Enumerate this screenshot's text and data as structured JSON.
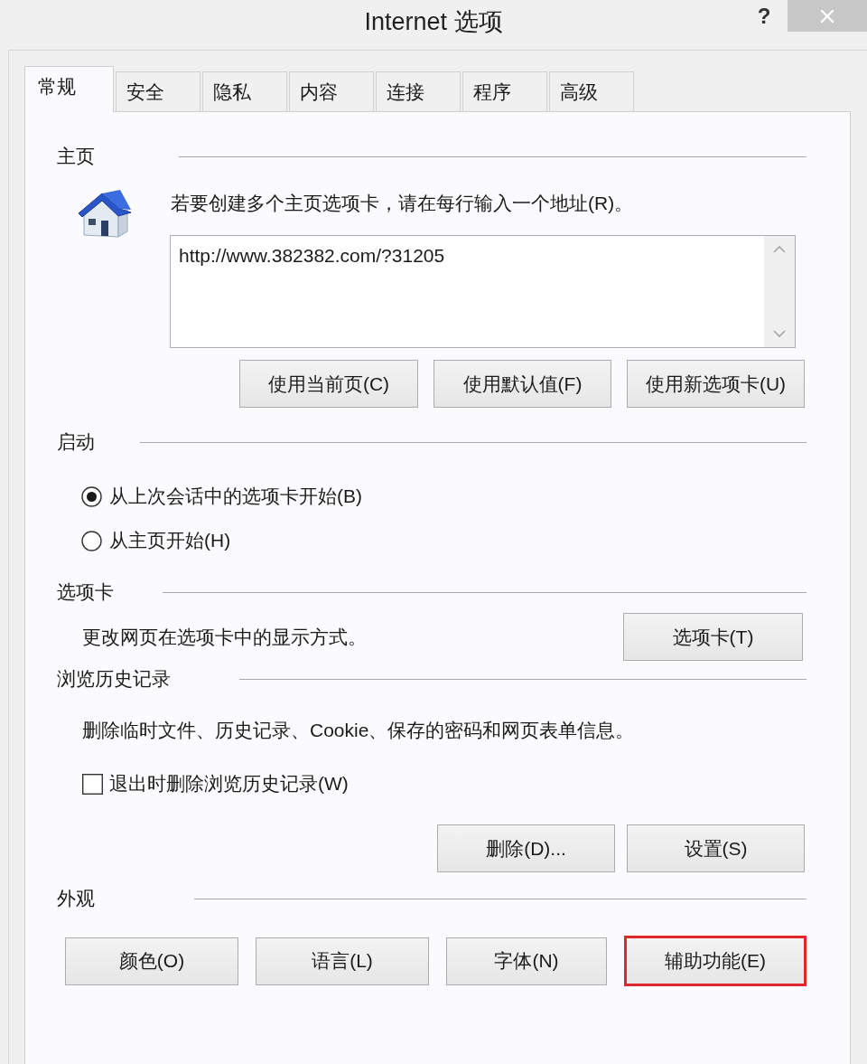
{
  "window": {
    "title": "Internet 选项",
    "help_button": "?"
  },
  "tabs": [
    {
      "label": "常规",
      "selected": true
    },
    {
      "label": "安全",
      "selected": false
    },
    {
      "label": "隐私",
      "selected": false
    },
    {
      "label": "内容",
      "selected": false
    },
    {
      "label": "连接",
      "selected": false
    },
    {
      "label": "程序",
      "selected": false
    },
    {
      "label": "高级",
      "selected": false
    }
  ],
  "sections": [
    {
      "kind": "home",
      "title": "主页",
      "instruction": "若要创建多个主页选项卡，请在每行输入一个地址(R)。",
      "address_box": {
        "value": "http://www.382382.com/?31205"
      },
      "buttons": [
        {
          "label": "使用当前页(C)",
          "highlighted": false
        },
        {
          "label": "使用默认值(F)",
          "highlighted": false
        },
        {
          "label": "使用新选项卡(U)",
          "highlighted": false
        }
      ]
    },
    {
      "kind": "startup",
      "title": "启动",
      "options": [
        {
          "label": "从上次会话中的选项卡开始(B)",
          "selected": true
        },
        {
          "label": "从主页开始(H)",
          "selected": false
        }
      ]
    },
    {
      "kind": "tabs",
      "title": "选项卡",
      "description": "更改网页在选项卡中的显示方式。",
      "buttons": [
        {
          "label": "选项卡(T)",
          "highlighted": false
        }
      ]
    },
    {
      "kind": "history",
      "title": "浏览历史记录",
      "description": "删除临时文件、历史记录、Cookie、保存的密码和网页表单信息。",
      "checkbox": {
        "label": "退出时删除浏览历史记录(W)",
        "checked": false
      },
      "buttons": [
        {
          "label": "删除(D)...",
          "highlighted": false
        },
        {
          "label": "设置(S)",
          "highlighted": false
        }
      ]
    },
    {
      "kind": "appearance",
      "title": "外观",
      "buttons": [
        {
          "label": "颜色(O)",
          "highlighted": false
        },
        {
          "label": "语言(L)",
          "highlighted": false
        },
        {
          "label": "字体(N)",
          "highlighted": false
        },
        {
          "label": "辅助功能(E)",
          "highlighted": true
        }
      ]
    }
  ]
}
